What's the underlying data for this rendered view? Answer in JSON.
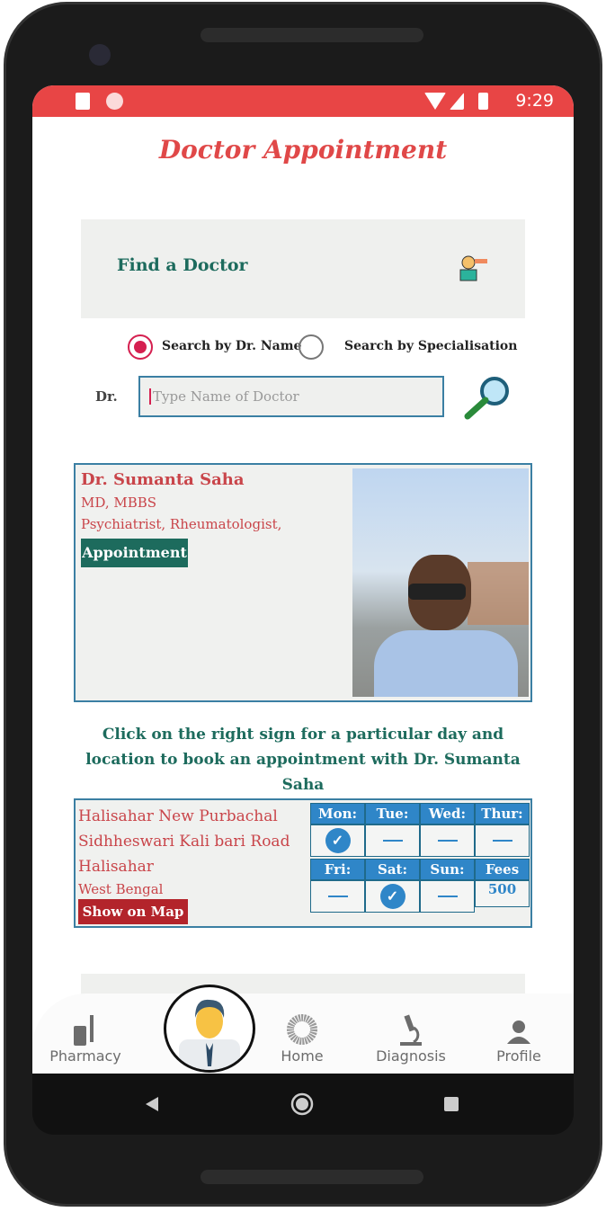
{
  "status": {
    "time": "9:29"
  },
  "header": {
    "title": "Doctor Appointment"
  },
  "find": {
    "label": "Find a Doctor"
  },
  "search": {
    "option1": "Search by Dr. Name",
    "option2": "Search by Specialisation",
    "selected": "Search by Dr. Name",
    "prefix": "Dr.",
    "placeholder": "Type Name of Doctor"
  },
  "doctor": {
    "name": "Dr. Sumanta Saha",
    "degree": "MD, MBBS",
    "specialisation": "Psychiatrist, Rheumatologist,",
    "appointment_label": "Appointment"
  },
  "message": "Click on the right sign for a particular day and location to book an appointment with Dr. Sumanta Saha",
  "location": {
    "line1": "Halisahar New Purbachal",
    "line2": "Sidhheswari Kali bari Road",
    "line3": "Halisahar",
    "line4": "West Bengal",
    "map_label": "Show on Map",
    "days": [
      {
        "label": "Mon:",
        "available": true
      },
      {
        "label": "Tue:",
        "available": false
      },
      {
        "label": "Wed:",
        "available": false
      },
      {
        "label": "Thur:",
        "available": false
      },
      {
        "label": "Fri:",
        "available": false
      },
      {
        "label": "Sat:",
        "available": true
      },
      {
        "label": "Sun:",
        "available": false
      }
    ],
    "fees_label": "Fees",
    "fees": "500"
  },
  "tabs": {
    "pharmacy": "Pharmacy",
    "home": "Home",
    "diagnosis": "Diagnosis",
    "profile": "Profile"
  },
  "colors": {
    "accent": "#e84545",
    "teal": "#1d6b5d",
    "blue": "#2f86c8"
  }
}
